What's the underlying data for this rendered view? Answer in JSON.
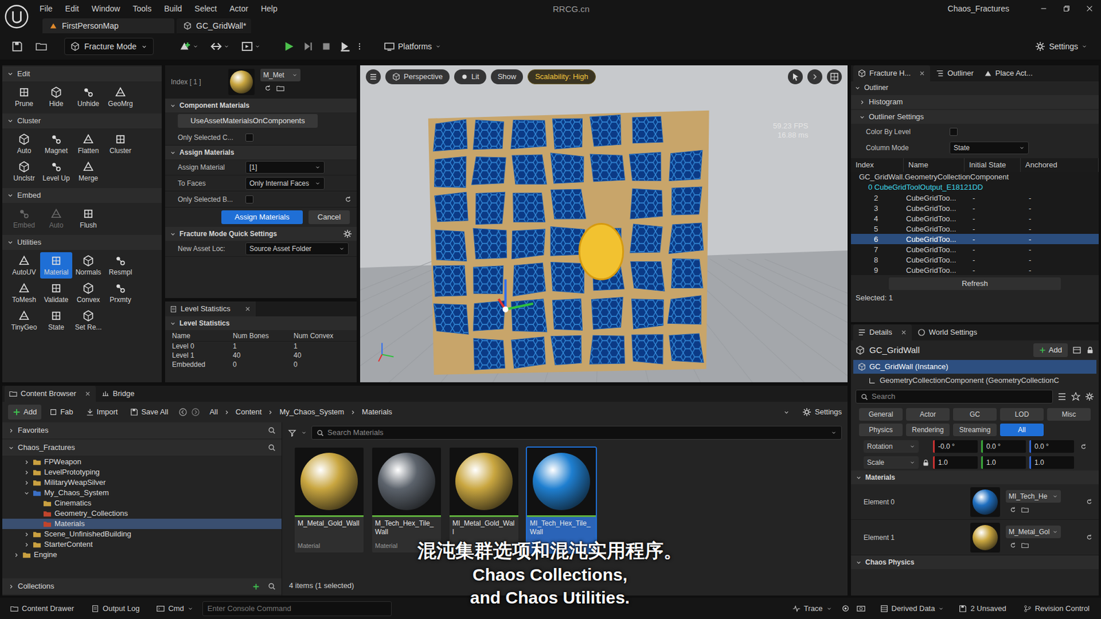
{
  "titlebar": {
    "menu": [
      "File",
      "Edit",
      "Window",
      "Tools",
      "Build",
      "Select",
      "Actor",
      "Help"
    ],
    "watermark": "RRCG.cn",
    "project": "Chaos_Fractures"
  },
  "doc_tabs": [
    {
      "label": "FirstPersonMap",
      "selected": true
    },
    {
      "label": "GC_GridWall*",
      "selected": false
    }
  ],
  "toolbar": {
    "mode": "Fracture Mode",
    "platforms": "Platforms",
    "settings": "Settings"
  },
  "fracture_sections": [
    {
      "title": "Edit",
      "expanded": true,
      "tools": [
        {
          "label": "Prune",
          "selected": false,
          "disabled": false
        },
        {
          "label": "Hide",
          "selected": false,
          "disabled": false
        },
        {
          "label": "Unhide",
          "selected": false,
          "disabled": false
        },
        {
          "label": "GeoMrg",
          "selected": false,
          "disabled": false
        }
      ]
    },
    {
      "title": "Cluster",
      "expanded": true,
      "tools": [
        {
          "label": "Auto",
          "selected": false,
          "disabled": false
        },
        {
          "label": "Magnet",
          "selected": false,
          "disabled": false
        },
        {
          "label": "Flatten",
          "selected": false,
          "disabled": false
        },
        {
          "label": "Cluster",
          "selected": false,
          "disabled": false
        },
        {
          "label": "Unclstr",
          "selected": false,
          "disabled": false
        },
        {
          "label": "Level Up",
          "selected": false,
          "disabled": false
        },
        {
          "label": "Merge",
          "selected": false,
          "disabled": false
        }
      ]
    },
    {
      "title": "Embed",
      "expanded": true,
      "tools": [
        {
          "label": "Embed",
          "selected": false,
          "disabled": true
        },
        {
          "label": "Auto",
          "selected": false,
          "disabled": true
        },
        {
          "label": "Flush",
          "selected": false,
          "disabled": false
        }
      ]
    },
    {
      "title": "Utilities",
      "expanded": true,
      "tools": [
        {
          "label": "AutoUV",
          "selected": false,
          "disabled": false
        },
        {
          "label": "Material",
          "selected": true,
          "disabled": false
        },
        {
          "label": "Normals",
          "selected": false,
          "disabled": false
        },
        {
          "label": "Resmpl",
          "selected": false,
          "disabled": false
        },
        {
          "label": "ToMesh",
          "selected": false,
          "disabled": false
        },
        {
          "label": "Validate",
          "selected": false,
          "disabled": false
        },
        {
          "label": "Convex",
          "selected": false,
          "disabled": false
        },
        {
          "label": "Prxmty",
          "selected": false,
          "disabled": false
        },
        {
          "label": "TinyGeo",
          "selected": false,
          "disabled": false
        },
        {
          "label": "State",
          "selected": false,
          "disabled": false
        },
        {
          "label": "Set Re...",
          "selected": false,
          "disabled": false
        }
      ]
    }
  ],
  "material_panel": {
    "index_label": "Index [ 1 ]",
    "material": "M_Met",
    "thumb_color": "#c9a640",
    "component_section": "Component Materials",
    "use_asset_button": "UseAssetMaterialsOnComponents",
    "only_selected_c": {
      "label": "Only Selected C...",
      "checked": false
    },
    "assign_section": "Assign Materials",
    "assign_material": {
      "label": "Assign Material",
      "value": "[1]"
    },
    "to_faces": {
      "label": "To Faces",
      "value": "Only Internal Faces"
    },
    "only_selected_b": {
      "label": "Only Selected B...",
      "checked": false
    },
    "assign_button": "Assign Materials",
    "cancel_button": "Cancel",
    "quick_settings": "Fracture Mode Quick Settings",
    "new_asset": {
      "label": "New Asset Loc:",
      "value": "Source Asset Folder"
    }
  },
  "level_statistics": {
    "tab": "Level Statistics",
    "section": "Level Statistics",
    "columns": [
      "Name",
      "Num Bones",
      "Num Convex"
    ],
    "rows": [
      [
        "Level 0",
        "1",
        "1"
      ],
      [
        "Level 1",
        "40",
        "40"
      ],
      [
        "Embedded",
        "0",
        "0"
      ]
    ]
  },
  "viewport": {
    "buttons": [
      {
        "label": "Perspective",
        "highlighted": false
      },
      {
        "label": "Lit",
        "highlighted": false
      },
      {
        "label": "Show",
        "highlighted": false
      },
      {
        "label": "Scalability: High",
        "highlighted": true
      }
    ],
    "fps": "59.23 FPS",
    "frame_time": "16.88 ms"
  },
  "outliner": {
    "tabs": [
      {
        "label": "Fracture H...",
        "selected": true
      },
      {
        "label": "Outliner",
        "selected": false
      },
      {
        "label": "Place Act...",
        "selected": false
      }
    ],
    "title": "Outliner",
    "histogram": {
      "label": "Histogram",
      "expanded": false
    },
    "settings": {
      "label": "Outliner Settings",
      "expanded": true
    },
    "color_by_level": {
      "label": "Color By Level",
      "checked": false
    },
    "column_mode": {
      "label": "Column Mode",
      "value": "State"
    },
    "columns": [
      "Index",
      "Name",
      "Initial State",
      "Anchored"
    ],
    "component": "GC_GridWall.GeometryCollectionComponent",
    "root": "0 CubeGridToolOutput_E18121DD",
    "rows": [
      {
        "index": "2",
        "name": "CubeGridToo...",
        "state": "-",
        "anchored": "-",
        "selected": false
      },
      {
        "index": "3",
        "name": "CubeGridToo...",
        "state": "-",
        "anchored": "-",
        "selected": false
      },
      {
        "index": "4",
        "name": "CubeGridToo...",
        "state": "-",
        "anchored": "-",
        "selected": false
      },
      {
        "index": "5",
        "name": "CubeGridToo...",
        "state": "-",
        "anchored": "-",
        "selected": false
      },
      {
        "index": "6",
        "name": "CubeGridToo...",
        "state": "-",
        "anchored": "-",
        "selected": true
      },
      {
        "index": "7",
        "name": "CubeGridToo...",
        "state": "-",
        "anchored": "-",
        "selected": false
      },
      {
        "index": "8",
        "name": "CubeGridToo...",
        "state": "-",
        "anchored": "-",
        "selected": false
      },
      {
        "index": "9",
        "name": "CubeGridToo...",
        "state": "-",
        "anchored": "-",
        "selected": false
      }
    ],
    "refresh": "Refresh",
    "selected_count": "Selected: 1"
  },
  "details": {
    "tabs": [
      {
        "label": "Details",
        "selected": true
      },
      {
        "label": "World Settings",
        "selected": false
      }
    ],
    "actor": "GC_GridWall",
    "add": "Add",
    "instance": "GC_GridWall (Instance)",
    "component": "GeometryCollectionComponent (GeometryCollectionC",
    "search": "Search",
    "filters": [
      {
        "label": "General",
        "selected": false
      },
      {
        "label": "Actor",
        "selected": false
      },
      {
        "label": "GC",
        "selected": false
      },
      {
        "label": "LOD",
        "selected": false
      },
      {
        "label": "Misc",
        "selected": false
      },
      {
        "label": "Physics",
        "selected": false
      },
      {
        "label": "Rendering",
        "selected": false
      },
      {
        "label": "Streaming",
        "selected": false
      },
      {
        "label": "All",
        "selected": true
      }
    ],
    "rotation": {
      "label": "Rotation",
      "values": [
        "-0.0 °",
        "0.0 °",
        "0.0 °"
      ]
    },
    "scale": {
      "label": "Scale",
      "values": [
        "1.0",
        "1.0",
        "1.0"
      ]
    },
    "materials_title": "Materials",
    "elements": [
      {
        "label": "Element 0",
        "material": "MI_Tech_He",
        "color": "#1f6fc0"
      },
      {
        "label": "Element 1",
        "material": "M_Metal_Gol",
        "color": "#c9a640"
      }
    ],
    "chaos_physics": "Chaos Physics"
  },
  "content_browser": {
    "tabs": [
      {
        "label": "Content Browser",
        "selected": true
      },
      {
        "label": "Bridge",
        "selected": false
      }
    ],
    "actions": [
      "Add",
      "Fab",
      "Import",
      "Save All"
    ],
    "path": [
      "All",
      "Content",
      "My_Chaos_System",
      "Materials"
    ],
    "settings": "Settings",
    "favorites": "Favorites",
    "root": "Chaos_Fractures",
    "tree": [
      {
        "label": "FPWeapon",
        "depth": 1,
        "expandable": true,
        "expanded": false,
        "selected": false,
        "color": "#c9a040"
      },
      {
        "label": "LevelPrototyping",
        "depth": 1,
        "expandable": true,
        "expanded": false,
        "selected": false,
        "color": "#c9a040"
      },
      {
        "label": "MilitaryWeapSilver",
        "depth": 1,
        "expandable": true,
        "expanded": false,
        "selected": false,
        "color": "#c9a040"
      },
      {
        "label": "My_Chaos_System",
        "depth": 1,
        "expandable": true,
        "expanded": true,
        "selected": false,
        "color": "#3b6fc4"
      },
      {
        "label": "Cinematics",
        "depth": 2,
        "expandable": false,
        "expanded": false,
        "selected": false,
        "color": "#c9a040"
      },
      {
        "label": "Geometry_Collections",
        "depth": 2,
        "expandable": false,
        "expanded": false,
        "selected": false,
        "color": "#c0442c"
      },
      {
        "label": "Materials",
        "depth": 2,
        "expandable": false,
        "expanded": false,
        "selected": true,
        "color": "#c0442c"
      },
      {
        "label": "Scene_UnfinishedBuilding",
        "depth": 1,
        "expandable": true,
        "expanded": false,
        "selected": false,
        "color": "#c9a040"
      },
      {
        "label": "StarterContent",
        "depth": 1,
        "expandable": true,
        "expanded": false,
        "selected": false,
        "color": "#c9a040"
      },
      {
        "label": "Engine",
        "depth": 0,
        "expandable": true,
        "expanded": false,
        "selected": false,
        "color": "#c9a040"
      }
    ],
    "collections": "Collections",
    "search": "Search Materials",
    "items": [
      {
        "name": "M_Metal_Gold_Wall",
        "type": "Material",
        "color": "#c9a640",
        "selected": false
      },
      {
        "name": "M_Tech_Hex_Tile_Wall",
        "type": "Material",
        "color": "#5c636c",
        "selected": false
      },
      {
        "name": "MI_Metal_Gold_Wall",
        "color": "#c9a640",
        "selected": false
      },
      {
        "name": "MI_Tech_Hex_Tile_Wall",
        "color": "#1f7fd0",
        "selected": true
      }
    ],
    "count": "4 items (1 selected)"
  },
  "status_bar": {
    "content_drawer": "Content Drawer",
    "output_log": "Output Log",
    "cmd": "Cmd",
    "console_placeholder": "Enter Console Command",
    "trace": "Trace",
    "derived_data": "Derived Data",
    "unsaved": "2 Unsaved",
    "revision": "Revision Control"
  },
  "subtitles": [
    "混沌集群选项和混沌实用程序。",
    "Chaos Collections,",
    "and Chaos Utilities."
  ]
}
